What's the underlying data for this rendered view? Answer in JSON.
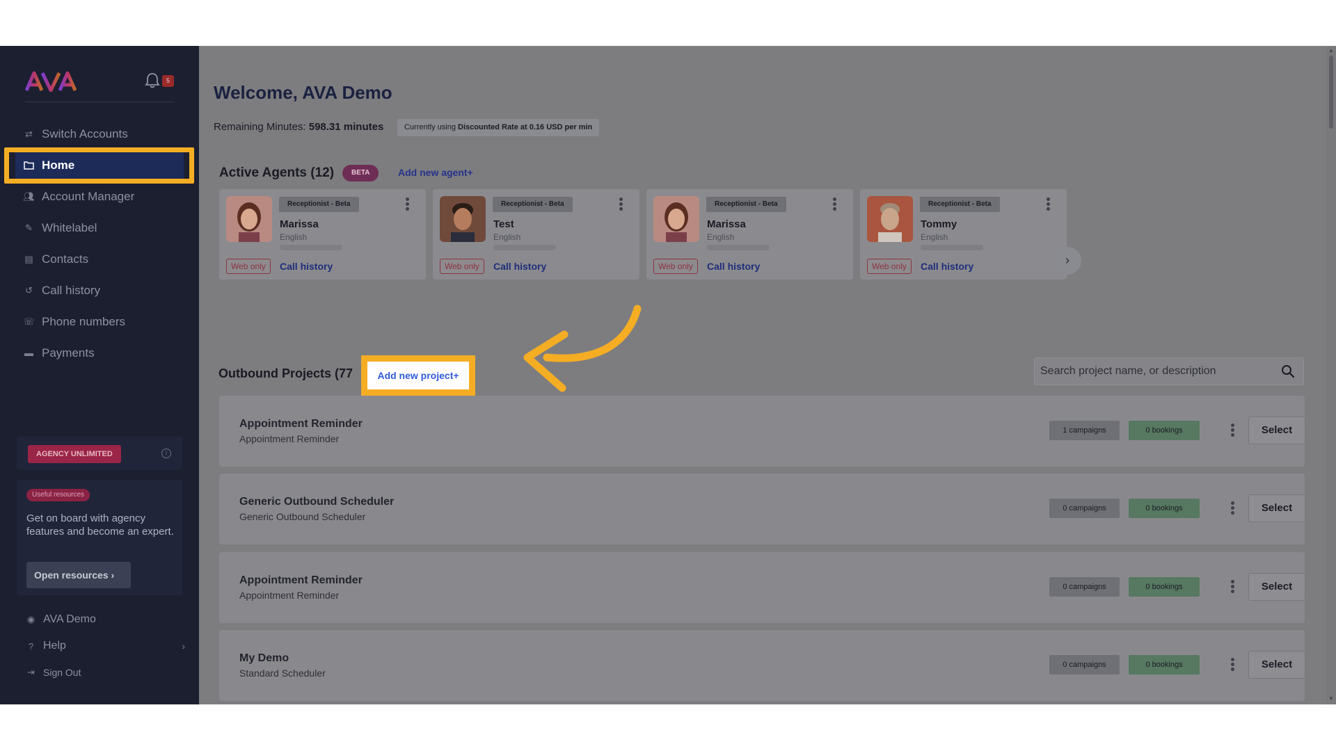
{
  "sidebar": {
    "logo": "AVA",
    "notification_count": "5",
    "nav": [
      {
        "label": "Switch Accounts",
        "icon": "swap-icon"
      },
      {
        "label": "Home",
        "icon": "folder-icon"
      },
      {
        "label": "Account Manager",
        "icon": "users-icon"
      },
      {
        "label": "Whitelabel",
        "icon": "brush-icon"
      },
      {
        "label": "Contacts",
        "icon": "contact-book-icon"
      },
      {
        "label": "Call history",
        "icon": "history-icon"
      },
      {
        "label": "Phone numbers",
        "icon": "phone-icon"
      },
      {
        "label": "Payments",
        "icon": "card-icon"
      }
    ],
    "plan_badge": "AGENCY UNLIMITED",
    "resources_badge": "Useful resources",
    "resources_text": "Get on board with agency features and become an expert.",
    "resources_button": "Open resources",
    "bottom": [
      {
        "label": "AVA Demo",
        "icon": "user-circle-icon"
      },
      {
        "label": "Help",
        "icon": "help-icon"
      },
      {
        "label": "Sign Out",
        "icon": "sign-out-icon"
      }
    ]
  },
  "main": {
    "welcome": "Welcome, AVA Demo",
    "remaining_label": "Remaining Minutes:",
    "remaining_value": "598.31 minutes",
    "rate_prefix": "Currently using",
    "rate_value": "Discounted Rate at 0.16 USD per min",
    "active_agents_title": "Active Agents (12)",
    "beta_badge": "BETA",
    "add_agent": "Add new agent+",
    "agents": [
      {
        "role": "Receptionist - Beta",
        "name": "Marissa",
        "language": "English",
        "tag": "Web only",
        "link": "Call history"
      },
      {
        "role": "Receptionist - Beta",
        "name": "Test",
        "language": "English",
        "tag": "Web only",
        "link": "Call history"
      },
      {
        "role": "Receptionist - Beta",
        "name": "Marissa",
        "language": "English",
        "tag": "Web only",
        "link": "Call history"
      },
      {
        "role": "Receptionist - Beta",
        "name": "Tommy",
        "language": "English",
        "tag": "Web only",
        "link": "Call history"
      }
    ],
    "outbound_title": "Outbound Projects (77",
    "add_project": "Add new project+",
    "search_placeholder": "Search project name, or description",
    "projects": [
      {
        "title": "Appointment Reminder",
        "subtitle": "Appointment Reminder",
        "campaigns": "1 campaigns",
        "bookings": "0 bookings",
        "action": "Select"
      },
      {
        "title": "Generic Outbound Scheduler",
        "subtitle": "Generic Outbound Scheduler",
        "campaigns": "0 campaigns",
        "bookings": "0 bookings",
        "action": "Select"
      },
      {
        "title": "Appointment Reminder",
        "subtitle": "Appointment Reminder",
        "campaigns": "0 campaigns",
        "bookings": "0 bookings",
        "action": "Select"
      },
      {
        "title": "My Demo",
        "subtitle": "Standard Scheduler",
        "campaigns": "0 campaigns",
        "bookings": "0 bookings",
        "action": "Select"
      }
    ]
  },
  "colors": {
    "highlight": "#f5ad24",
    "sidebar_bg": "#1b1f30",
    "overlay_bg": "#7d7d80",
    "link_blue": "#2f5bd8"
  }
}
